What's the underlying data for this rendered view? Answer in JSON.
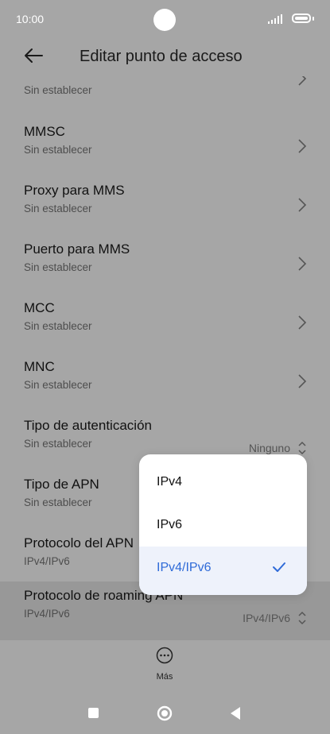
{
  "status_bar": {
    "time": "10:00"
  },
  "header": {
    "title": "Editar punto de acceso"
  },
  "list": {
    "items": [
      {
        "title": "",
        "subtitle": "Sin establecer"
      },
      {
        "title": "MMSC",
        "subtitle": "Sin establecer"
      },
      {
        "title": "Proxy para MMS",
        "subtitle": "Sin establecer"
      },
      {
        "title": "Puerto para MMS",
        "subtitle": "Sin establecer"
      },
      {
        "title": "MCC",
        "subtitle": "Sin establecer"
      },
      {
        "title": "MNC",
        "subtitle": "Sin establecer"
      },
      {
        "title": "Tipo de autenticación",
        "subtitle": "Sin establecer",
        "value": "Ninguno"
      },
      {
        "title": "Tipo de APN",
        "subtitle": "Sin establecer"
      },
      {
        "title": "Protocolo del APN",
        "subtitle": "IPv4/IPv6"
      },
      {
        "title": "Protocolo de roaming APN",
        "subtitle": "IPv4/IPv6",
        "value": "IPv4/IPv6"
      }
    ]
  },
  "dropdown": {
    "options": [
      {
        "label": "IPv4"
      },
      {
        "label": "IPv6"
      },
      {
        "label": "IPv4/IPv6"
      }
    ],
    "selected_index": 2,
    "accent": "#2f6bd8"
  },
  "bottom": {
    "more_label": "Más"
  }
}
